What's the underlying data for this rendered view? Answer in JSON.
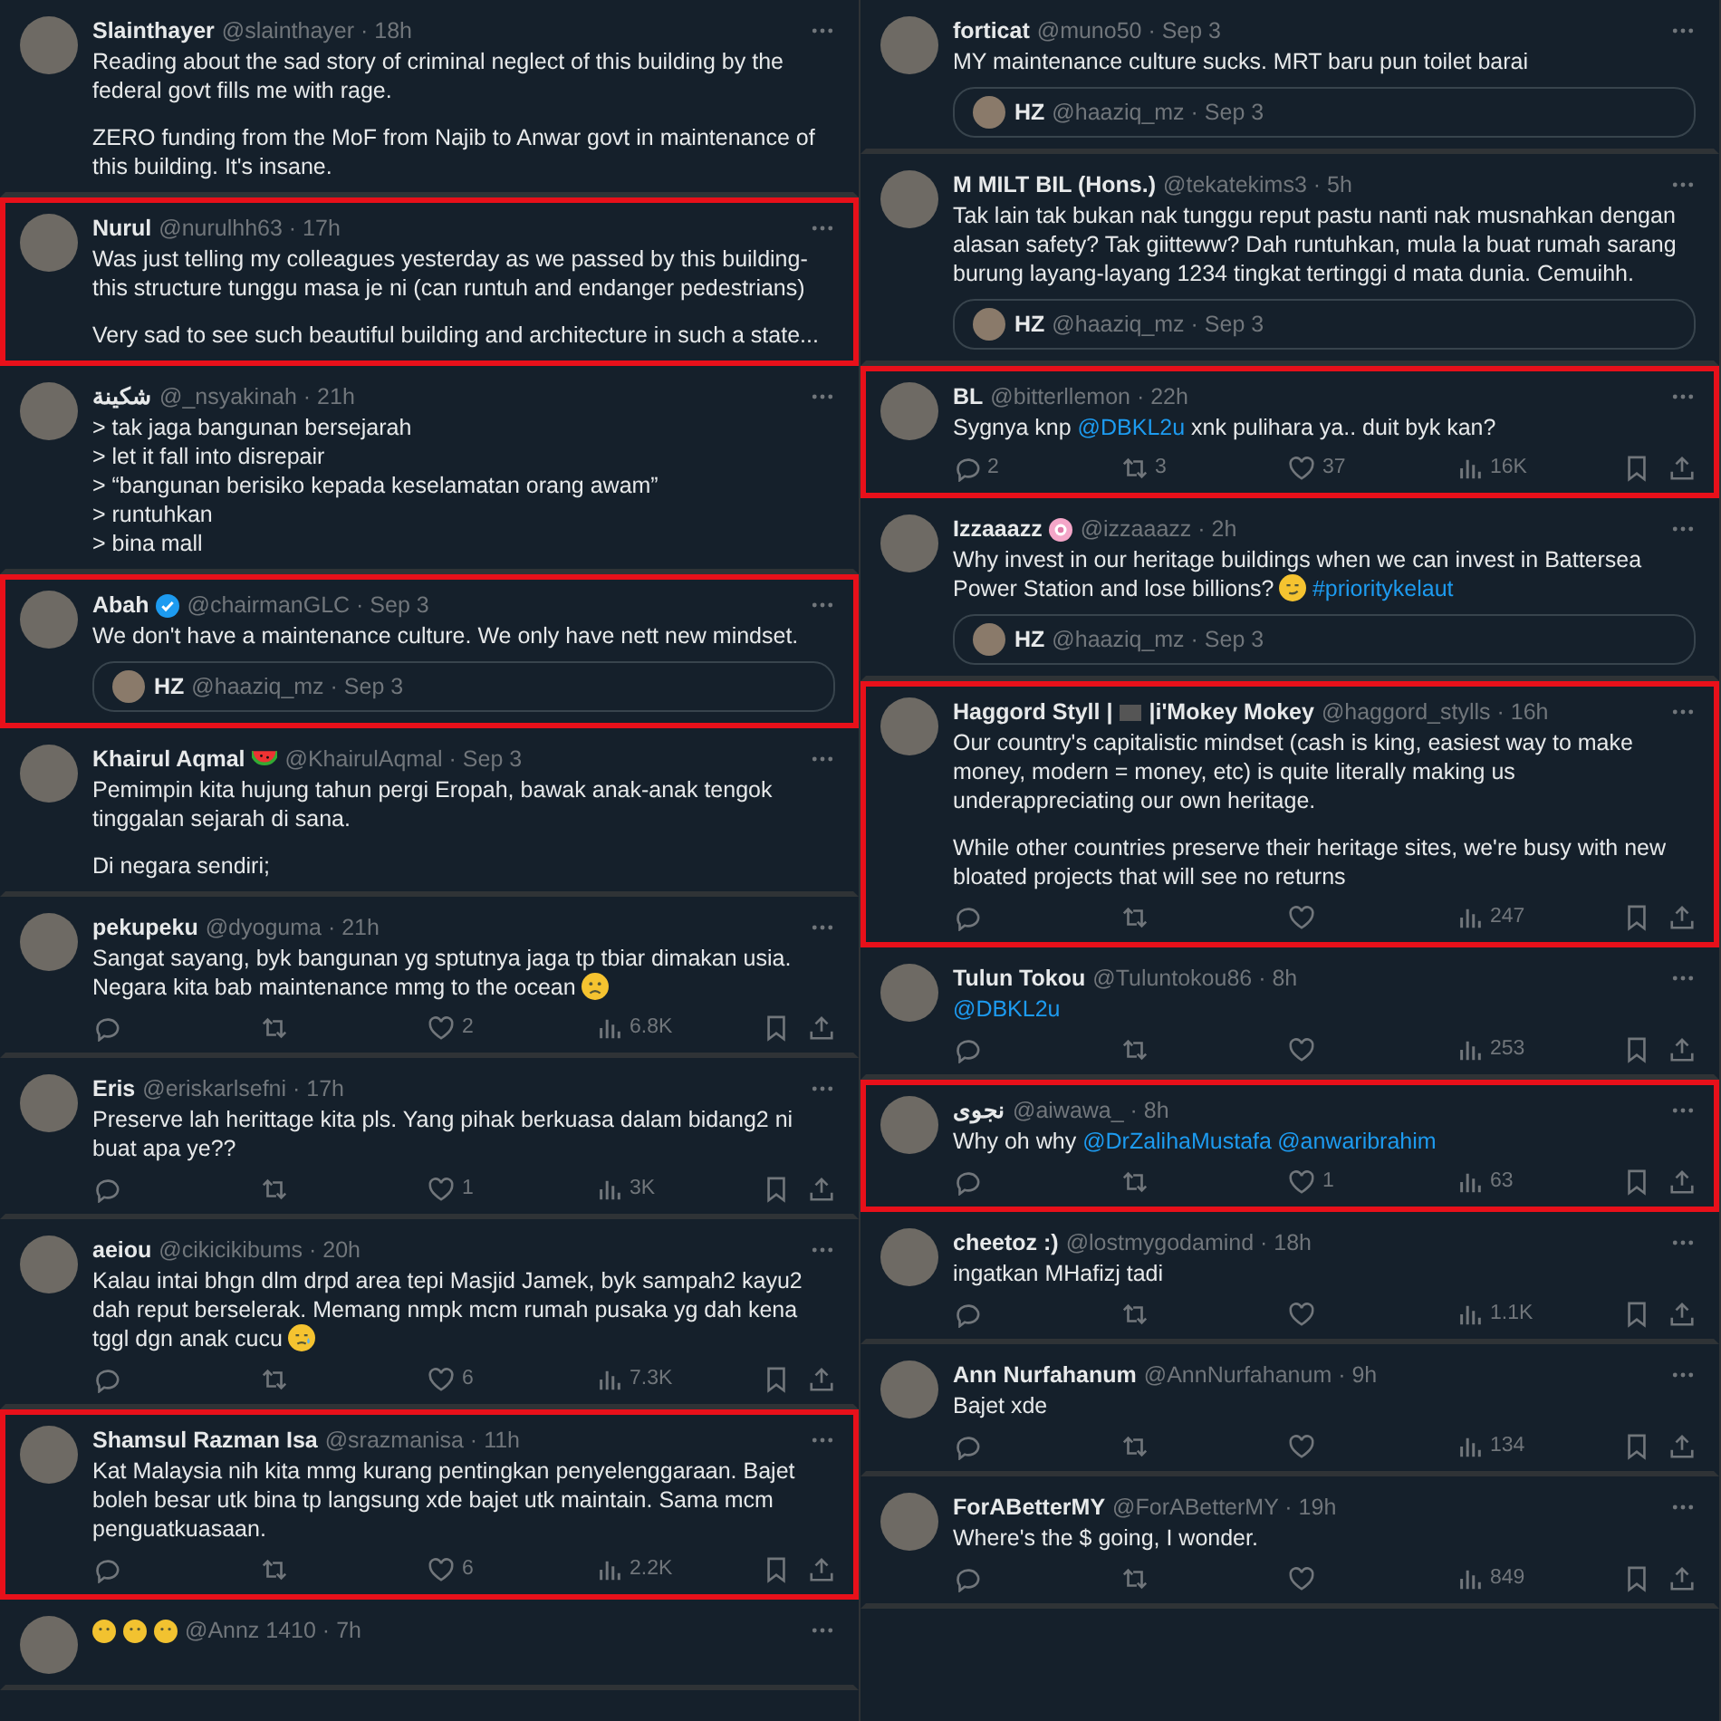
{
  "columns": [
    {
      "tweets": [
        {
          "name": "Slainthayer",
          "byline": "@slainthayer · 18h",
          "highlighted": false,
          "body": [
            [
              {
                "kind": "text",
                "text": "Reading about the sad story of criminal neglect of this building by the federal govt fills me with rage."
              }
            ],
            [
              {
                "kind": "text",
                "text": "ZERO funding from the MoF from Najib to Anwar govt in maintenance of this building. It's insane."
              }
            ]
          ]
        },
        {
          "name": "Nurul",
          "byline": "@nurulhh63 · 17h",
          "highlighted": true,
          "body": [
            [
              {
                "kind": "text",
                "text": "Was just telling my colleagues yesterday as we passed by this building- this structure tunggu masa je ni (can runtuh and endanger pedestrians)"
              }
            ],
            [
              {
                "kind": "text",
                "text": "Very sad to see such beautiful building and architecture in such a state..."
              }
            ]
          ]
        },
        {
          "name": "شكينة",
          "byline": "@_nsyakinah · 21h",
          "highlighted": false,
          "body": [
            [
              {
                "kind": "text",
                "text": "> tak jaga bangunan bersejarah\n> let it fall into disrepair\n> “bangunan berisiko kepada keselamatan orang awam”\n> runtuhkan\n> bina mall"
              }
            ]
          ]
        },
        {
          "name": "Abah",
          "badges": [
            {
              "kind": "verified"
            }
          ],
          "byline": "@chairmanGLC · Sep 3",
          "highlighted": true,
          "body": [
            [
              {
                "kind": "text",
                "text": "We don't have a maintenance culture. We only have nett new mindset."
              }
            ]
          ],
          "quote": {
            "name": "HZ",
            "byline": "@haaziq_mz · Sep 3"
          }
        },
        {
          "name": "Khairul Aqmal",
          "badges": [
            {
              "kind": "watermelon"
            }
          ],
          "byline": "@KhairulAqmal · Sep 3",
          "highlighted": false,
          "body": [
            [
              {
                "kind": "text",
                "text": "Pemimpin kita hujung tahun pergi Eropah, bawak anak-anak tengok tinggalan sejarah di sana."
              }
            ],
            [
              {
                "kind": "text",
                "text": "Di negara sendiri;"
              }
            ]
          ]
        },
        {
          "name": "pekupeku",
          "byline": "@dyoguma · 21h",
          "highlighted": false,
          "body": [
            [
              {
                "kind": "text",
                "text": "Sangat sayang, byk bangunan yg sptutnya jaga tp tbiar dimakan usia. Negara kita bab maintenance mmg to the ocean"
              },
              {
                "kind": "frown"
              }
            ]
          ],
          "actions": {
            "like": "2",
            "views": "6.8K"
          }
        },
        {
          "name": "Eris",
          "byline": "@eriskarlsefni · 17h",
          "highlighted": false,
          "body": [
            [
              {
                "kind": "text",
                "text": "Preserve lah herittage kita pls. Yang pihak berkuasa dalam bidang2 ni buat apa ye??"
              }
            ]
          ],
          "actions": {
            "like": "1",
            "views": "3K"
          }
        },
        {
          "name": "aeiou",
          "byline": "@cikicikibums · 20h",
          "highlighted": false,
          "body": [
            [
              {
                "kind": "text",
                "text": "Kalau intai bhgn dlm drpd area tepi Masjid Jamek, byk sampah2 kayu2 dah reput berselerak. Memang nmpk mcm rumah pusaka yg dah kena tggl dgn anak cucu"
              },
              {
                "kind": "tear"
              }
            ]
          ],
          "actions": {
            "like": "6",
            "views": "7.3K"
          }
        },
        {
          "name": "Shamsul Razman Isa",
          "byline": "@srazmanisa · 11h",
          "highlighted": true,
          "body": [
            [
              {
                "kind": "text",
                "text": "Kat Malaysia nih kita mmg kurang pentingkan penyelenggaraan. Bajet boleh besar utk bina tp langsung xde bajet utk maintain. Sama mcm penguatkuasaan."
              }
            ]
          ],
          "actions": {
            "like": "6",
            "views": "2.2K"
          }
        },
        {
          "badges": [
            {
              "kind": "emoji"
            },
            {
              "kind": "emoji"
            },
            {
              "kind": "emoji"
            }
          ],
          "byline": "@Annz 1410 · 7h",
          "highlighted": false
        }
      ]
    },
    {
      "tweets": [
        {
          "name": "forticat",
          "byline": "@muno50 · Sep 3",
          "highlighted": false,
          "body": [
            [
              {
                "kind": "text",
                "text": "MY maintenance culture sucks. MRT baru pun toilet barai"
              }
            ]
          ],
          "quote": {
            "name": "HZ",
            "byline": "@haaziq_mz · Sep 3"
          }
        },
        {
          "name": "M MILT BIL (Hons.)",
          "byline": "@tekatekims3 · 5h",
          "highlighted": false,
          "body": [
            [
              {
                "kind": "text",
                "text": "Tak lain tak bukan nak tunggu reput pastu nanti nak musnahkan dengan alasan safety? Tak giitteww? Dah runtuhkan, mula la buat rumah sarang burung layang-layang 1234 tingkat tertinggi d mata dunia. Cemuihh."
              }
            ]
          ],
          "quote": {
            "name": "HZ",
            "byline": "@haaziq_mz · Sep 3"
          }
        },
        {
          "name": "BL",
          "byline": "@bitterllemon · 22h",
          "highlighted": true,
          "body": [
            [
              {
                "kind": "text",
                "text": "Sygnya knp "
              },
              {
                "kind": "link",
                "text": "@DBKL2u"
              },
              {
                "kind": "text",
                "text": " xnk pulihara ya.. duit byk kan?"
              }
            ]
          ],
          "actions": {
            "reply": "2",
            "retweet": "3",
            "like": "37",
            "views": "16K"
          }
        },
        {
          "name": "Izzaaazz",
          "badges": [
            {
              "kind": "flower"
            }
          ],
          "byline": "@izzaaazz · 2h",
          "highlighted": false,
          "body": [
            [
              {
                "kind": "text",
                "text": "Why invest in our heritage buildings when we can invest in Battersea Power Station and lose billions?"
              },
              {
                "kind": "smirk"
              },
              {
                "kind": "link",
                "text": "#prioritykelaut"
              }
            ]
          ],
          "quote": {
            "name": "HZ",
            "byline": "@haaziq_mz · Sep 3"
          }
        },
        {
          "name": "Haggord Styll |",
          "badges": [
            {
              "kind": "flag"
            }
          ],
          "name_suffix": "|i'Mokey Mokey",
          "byline": "@haggord_stylls · 16h",
          "highlighted": true,
          "body": [
            [
              {
                "kind": "text",
                "text": "Our country's capitalistic mindset (cash is king, easiest way to make money, modern = money, etc) is quite literally making us underappreciating our own heritage."
              }
            ],
            [
              {
                "kind": "text",
                "text": "While other countries preserve their heritage sites, we're busy with new bloated projects that will see no returns"
              }
            ]
          ],
          "actions": {
            "views": "247"
          }
        },
        {
          "name": "Tulun Tokou",
          "byline": "@Tuluntokou86 · 8h",
          "highlighted": false,
          "body": [
            [
              {
                "kind": "link",
                "text": "@DBKL2u"
              }
            ]
          ],
          "actions": {
            "views": "253"
          }
        },
        {
          "name": "نجوى",
          "byline": "@aiwawa_ · 8h",
          "highlighted": true,
          "body": [
            [
              {
                "kind": "text",
                "text": "Why oh why "
              },
              {
                "kind": "link",
                "text": "@DrZalihaMustafa"
              },
              {
                "kind": "link",
                "text": "@anwaribrahim"
              }
            ]
          ],
          "actions": {
            "like": "1",
            "views": "63"
          }
        },
        {
          "name": "cheetoz :)",
          "byline": "@lostmygodamind · 18h",
          "highlighted": false,
          "body": [
            [
              {
                "kind": "text",
                "text": "ingatkan MHafizj tadi"
              }
            ]
          ],
          "actions": {
            "views": "1.1K"
          }
        },
        {
          "name": "Ann Nurfahanum",
          "byline": "@AnnNurfahanum · 9h",
          "highlighted": false,
          "body": [
            [
              {
                "kind": "text",
                "text": "Bajet xde"
              }
            ]
          ],
          "actions": {
            "views": "134"
          }
        },
        {
          "name": "ForABetterMY",
          "byline": "@ForABetterMY · 19h",
          "highlighted": false,
          "body": [
            [
              {
                "kind": "text",
                "text": "Where's the $ going, I wonder."
              }
            ]
          ],
          "actions": {
            "views": "849"
          }
        }
      ]
    }
  ]
}
